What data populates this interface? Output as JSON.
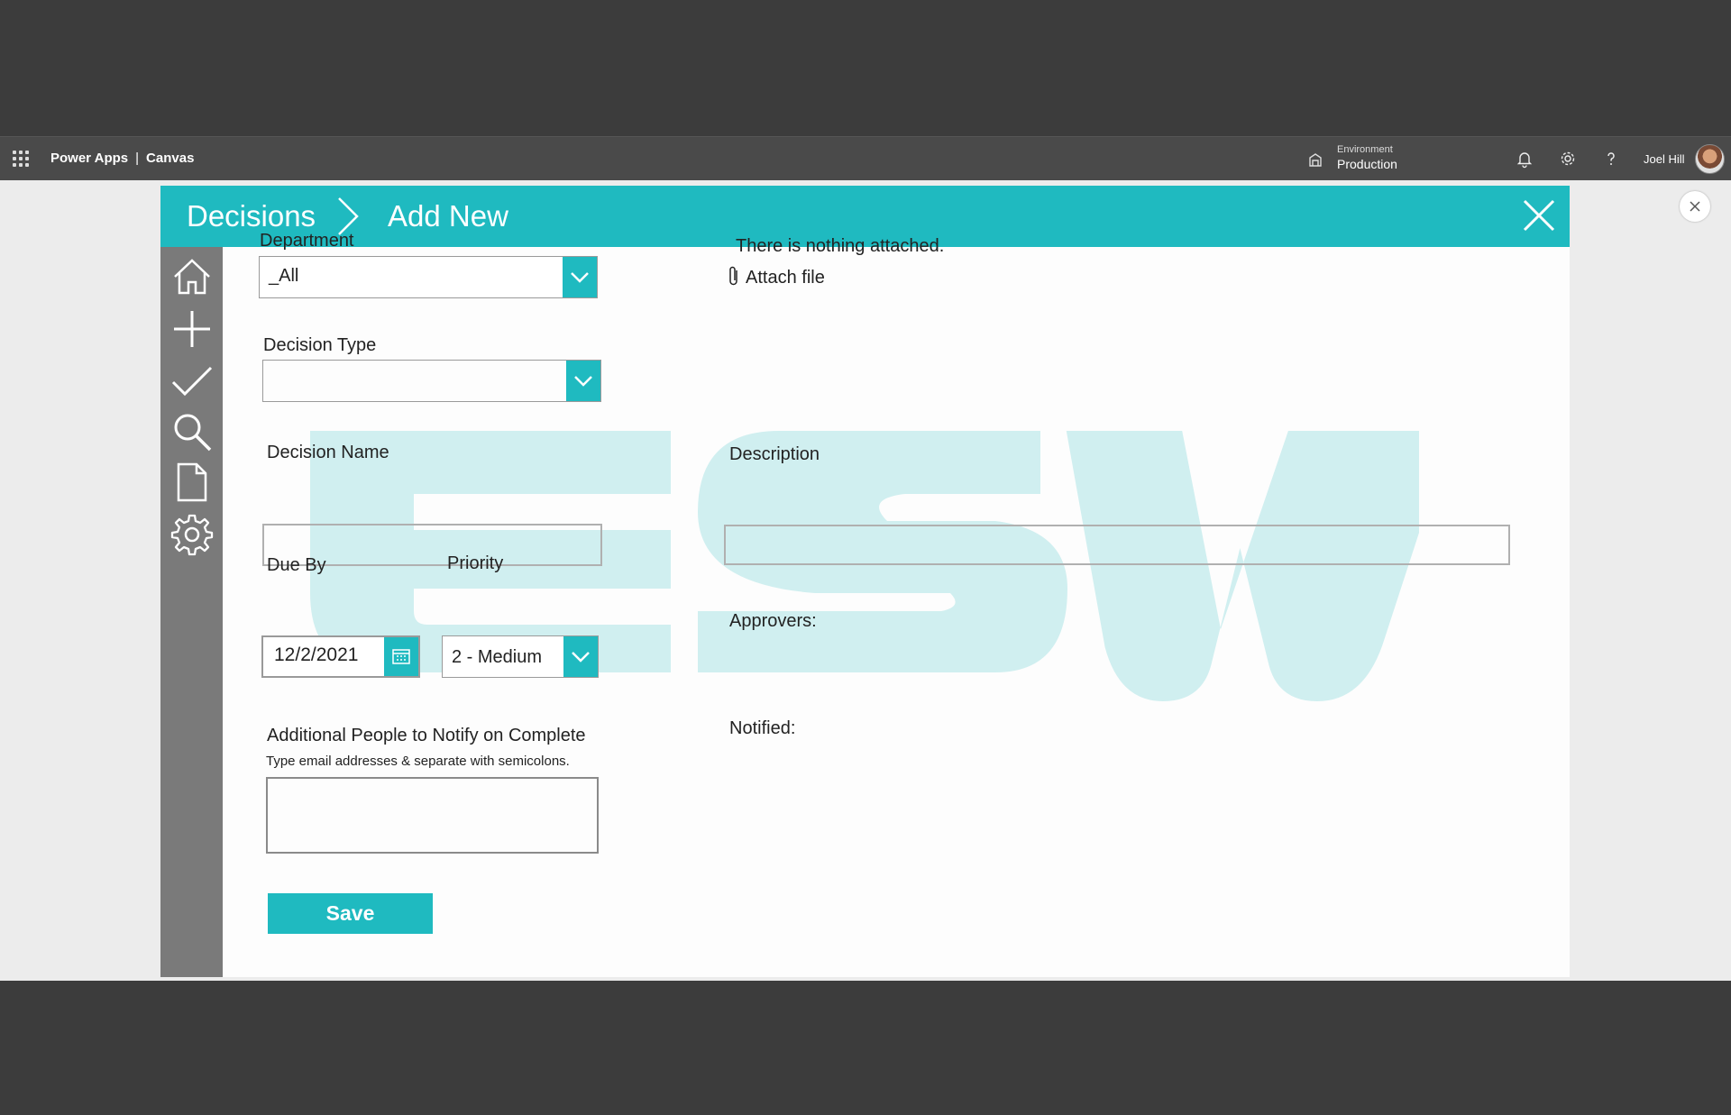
{
  "suitebar": {
    "brand": "Power Apps",
    "separator": "|",
    "product": "Canvas",
    "environment_label": "Environment",
    "environment_value": "Production",
    "user_name": "Joel Hill"
  },
  "header": {
    "breadcrumb_root": "Decisions",
    "breadcrumb_current": "Add New"
  },
  "form": {
    "department_label": "Department",
    "department_value": "_All",
    "decision_type_label": "Decision Type",
    "decision_type_value": "",
    "decision_name_label": "Decision Name",
    "decision_name_value": "",
    "due_by_label": "Due By",
    "due_by_value": "12/2/2021",
    "priority_label": "Priority",
    "priority_value": "2 - Medium",
    "notify_label": "Additional People to Notify on Complete",
    "notify_hint": "Type email addresses & separate with semicolons.",
    "notify_value": "",
    "save_label": "Save"
  },
  "right": {
    "attachments_empty": "There is nothing attached.",
    "attach_file": "Attach file",
    "description_label": "Description",
    "description_value": "",
    "approvers_label": "Approvers:",
    "notified_label": "Notified:"
  },
  "colors": {
    "accent": "#1fbac0",
    "sidenav": "#7a7a7a",
    "suitebar": "#4a4a4a"
  },
  "icons": {
    "nav": [
      "home-icon",
      "add-icon",
      "checkmark-icon",
      "search-icon",
      "document-icon",
      "settings-icon"
    ]
  }
}
